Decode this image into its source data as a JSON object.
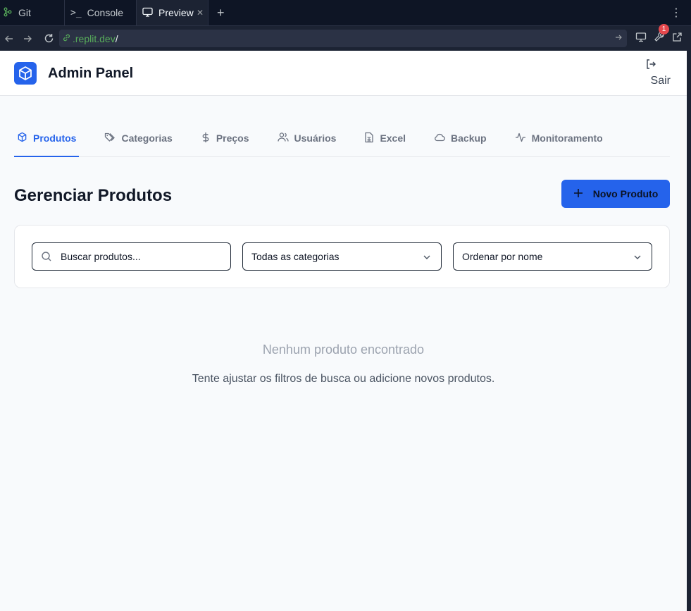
{
  "ide": {
    "tabs": [
      {
        "label": "Git"
      },
      {
        "label": "Console"
      },
      {
        "label": "Preview"
      }
    ],
    "url": {
      "host": ".replit.dev",
      "path": "/"
    },
    "notification_count": "1"
  },
  "header": {
    "title": "Admin Panel",
    "logout_label": "Sair"
  },
  "nav": {
    "tabs": [
      {
        "label": "Produtos",
        "icon": "box-icon",
        "active": true
      },
      {
        "label": "Categorias",
        "icon": "tags-icon"
      },
      {
        "label": "Preços",
        "icon": "dollar-icon"
      },
      {
        "label": "Usuários",
        "icon": "users-icon"
      },
      {
        "label": "Excel",
        "icon": "spreadsheet-icon"
      },
      {
        "label": "Backup",
        "icon": "cloud-icon"
      },
      {
        "label": "Monitoramento",
        "icon": "activity-icon"
      }
    ]
  },
  "main": {
    "title": "Gerenciar Produtos",
    "new_button": "Novo Produto",
    "filters": {
      "search_placeholder": "Buscar produtos...",
      "category_value": "Todas as categorias",
      "order_value": "Ordenar por nome"
    },
    "empty": {
      "title": "Nenhum produto encontrado",
      "message": "Tente ajustar os filtros de busca ou adicione novos produtos."
    }
  },
  "colors": {
    "accent": "#2563eb",
    "header_bg": "#ffffff",
    "page_bg": "#f8fafc",
    "ide_bg": "#0e1525"
  }
}
